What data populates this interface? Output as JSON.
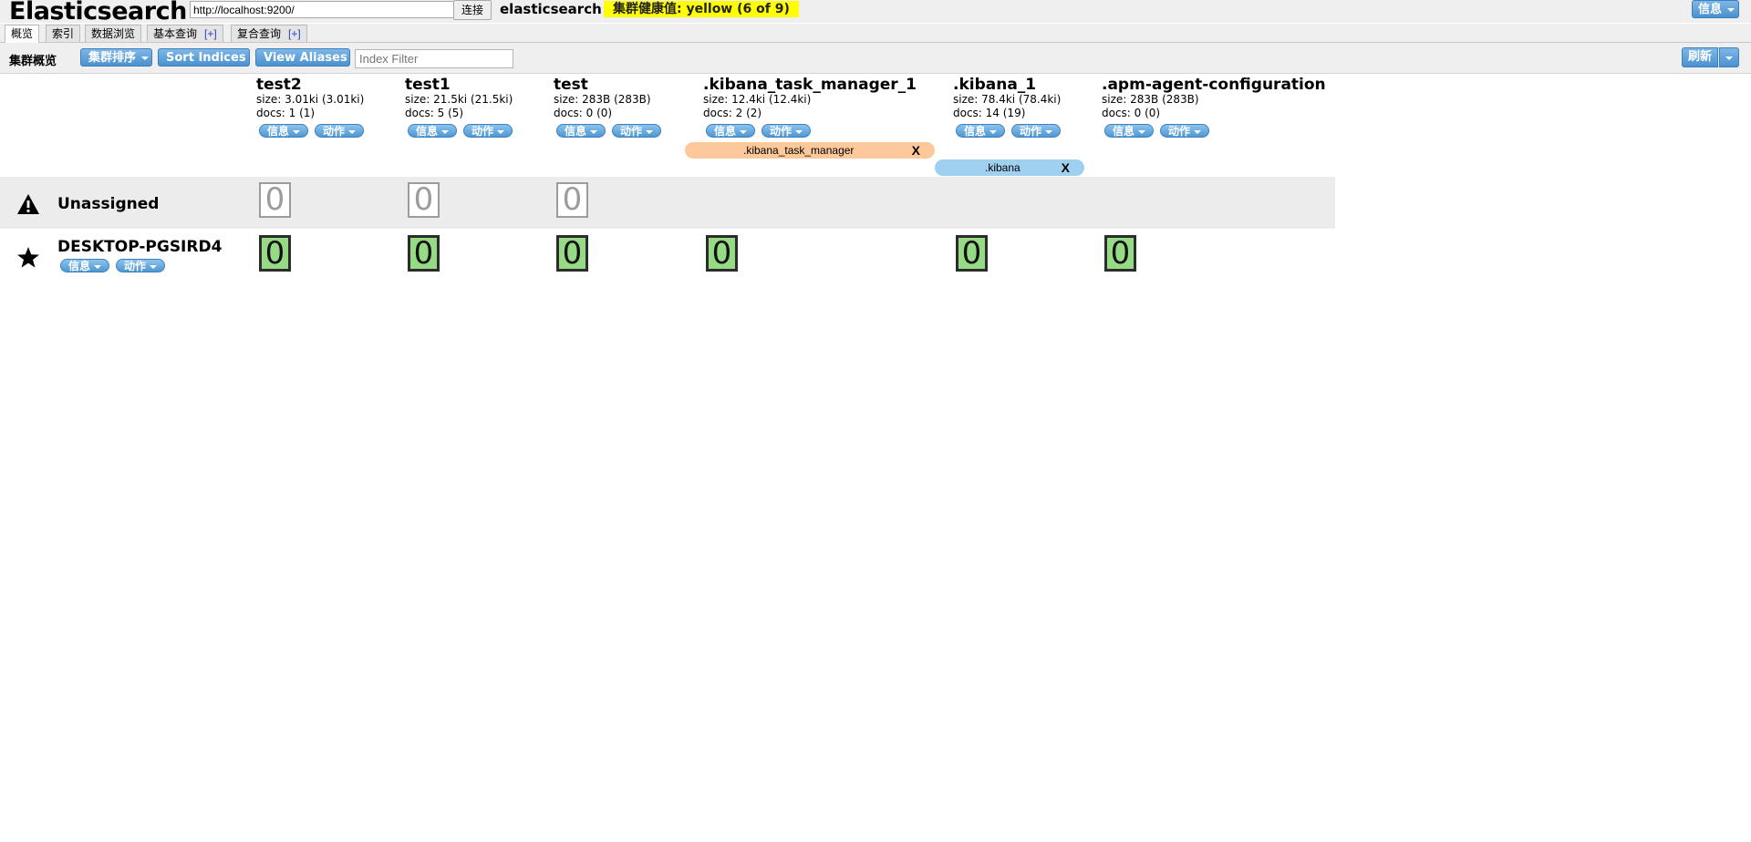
{
  "header": {
    "app_title": "Elasticsearch",
    "url_value": "http://localhost:9200/",
    "connect_label": "连接",
    "cluster_name": "elasticsearch",
    "health_text": "集群健康值: yellow (6 of 9)",
    "info_menu_label": "信息"
  },
  "tabs": [
    {
      "label": "概览",
      "active": true
    },
    {
      "label": "索引"
    },
    {
      "label": "数据浏览"
    },
    {
      "label": "基本查询",
      "plus": "[+]"
    },
    {
      "label": "复合查询",
      "plus": "[+]"
    }
  ],
  "toolbar": {
    "overview_label": "集群概览",
    "sort_cluster_label": "集群排序",
    "sort_indices_label": "Sort Indices",
    "view_aliases_label": "View Aliases",
    "index_filter_placeholder": "Index Filter",
    "refresh_label": "刷新"
  },
  "indices": [
    {
      "name": "test2",
      "size": "size: 3.01ki (3.01ki)",
      "docs": "docs: 1 (1)",
      "info_label": "信息",
      "action_label": "动作"
    },
    {
      "name": "test1",
      "size": "size: 21.5ki (21.5ki)",
      "docs": "docs: 5 (5)",
      "info_label": "信息",
      "action_label": "动作"
    },
    {
      "name": "test",
      "size": "size: 283B (283B)",
      "docs": "docs: 0 (0)",
      "info_label": "信息",
      "action_label": "动作"
    },
    {
      "name": ".kibana_task_manager_1",
      "size": "size: 12.4ki (12.4ki)",
      "docs": "docs: 2 (2)",
      "info_label": "信息",
      "action_label": "动作"
    },
    {
      "name": ".kibana_1",
      "size": "size: 78.4ki (78.4ki)",
      "docs": "docs: 14 (19)",
      "info_label": "信息",
      "action_label": "动作"
    },
    {
      "name": ".apm-agent-configuration",
      "size": "size: 283B (283B)",
      "docs": "docs: 0 (0)",
      "info_label": "信息",
      "action_label": "动作"
    }
  ],
  "aliases": [
    {
      "name": ".kibana_task_manager",
      "remove": "X",
      "color": "#fdc89a"
    },
    {
      "name": ".kibana",
      "remove": "X",
      "color": "#9fd0f0"
    }
  ],
  "unassigned": {
    "label": "Unassigned",
    "icon": "warning-icon",
    "shards": [
      "0",
      "0",
      "0"
    ]
  },
  "node": {
    "name": "DESKTOP-PGSIRD4",
    "icon": "star-icon",
    "info_label": "信息",
    "action_label": "动作",
    "shards": [
      "0",
      "0",
      "0",
      "0",
      "0",
      "0"
    ]
  },
  "colors": {
    "health_yellow": "#ffff00",
    "shard_green": "#97da85",
    "button_blue": "#4a92d0"
  }
}
